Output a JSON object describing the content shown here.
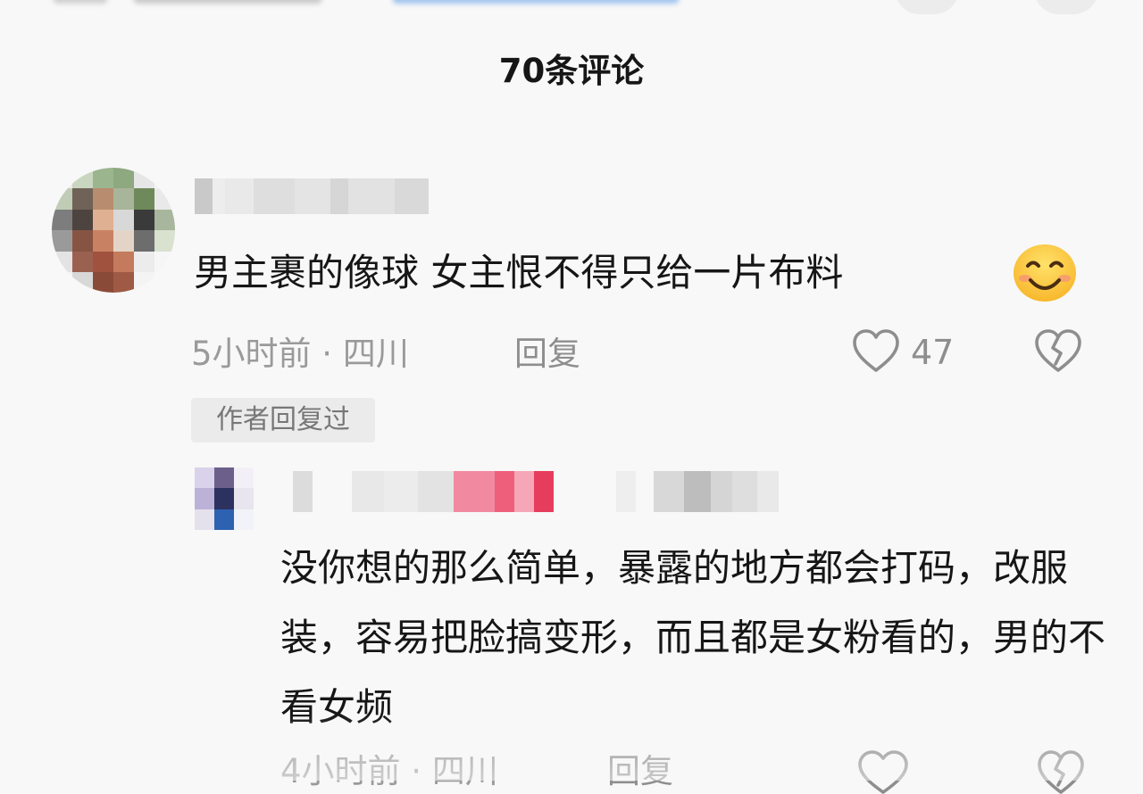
{
  "header": {
    "title": "70条评论"
  },
  "comment": {
    "text": "男主裹的像球 女主恨不得只给一片布料",
    "emoji": "smile-emoji",
    "time_location": "5小时前 · 四川",
    "reply_label": "回复",
    "likes": "47",
    "author_badge": "作者回复过"
  },
  "reply": {
    "text": "没你想的那么简单，暴露的地方都会打码，改服装，容易把脸搞变形，而且都是女粉看的，男的不看女频",
    "time_location": "4小时前 · 四川",
    "reply_label": "回复"
  },
  "icons": {
    "like": "heart-outline-icon",
    "dislike": "broken-heart-icon"
  },
  "colors": {
    "background": "#f8f8f8",
    "text": "#161616",
    "secondary_text": "#9a9a9a",
    "badge_bg": "#ebebeb",
    "pink_mosaic": "#f0708a"
  }
}
